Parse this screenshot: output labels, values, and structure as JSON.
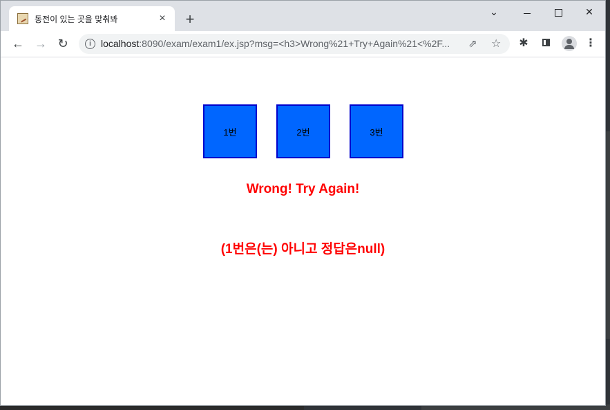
{
  "tab": {
    "title": "동전이 있는 곳을 맞춰봐",
    "close": "×",
    "new_tab": "+"
  },
  "window_controls": {
    "tab_search": "⌄",
    "close": "✕"
  },
  "address_bar": {
    "host": "localhost",
    "path": ":8090/exam/exam1/ex.jsp?msg=<h3>Wrong%21+Try+Again%21<%2F..."
  },
  "toolbar": {
    "back": "←",
    "forward": "→",
    "reload": "↻",
    "share": "⇗",
    "star": "☆",
    "extensions": "✱",
    "menu": "⋮"
  },
  "boxes": [
    {
      "label": "1번"
    },
    {
      "label": "2번"
    },
    {
      "label": "3번"
    }
  ],
  "messages": {
    "wrong": "Wrong! Try Again!",
    "detail": "(1번은(는) 아니고 정답은null)"
  },
  "colors": {
    "box_fill": "#0066ff",
    "box_border": "#0000cc",
    "message": "#ff0000"
  }
}
